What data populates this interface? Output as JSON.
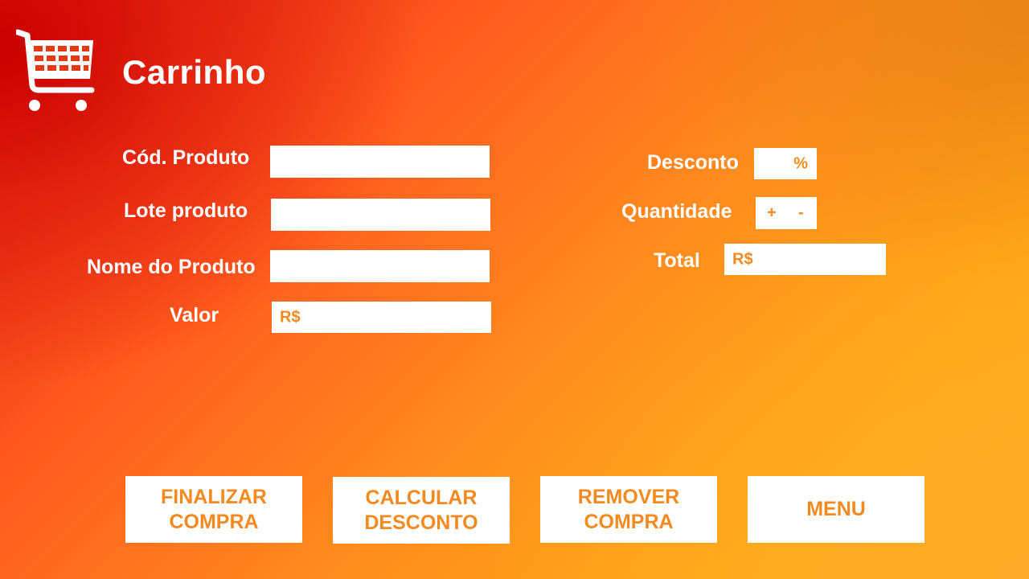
{
  "header": {
    "title": "Carrinho",
    "icon": "shopping-cart-icon"
  },
  "form": {
    "codigo_label": "Cód. Produto",
    "codigo_value": "",
    "lote_label": "Lote produto",
    "lote_value": "",
    "nome_label": "Nome do Produto",
    "nome_value": "",
    "valor_label": "Valor",
    "valor_prefix": "R$",
    "valor_value": "",
    "desconto_label": "Desconto",
    "desconto_suffix": "%",
    "desconto_value": "",
    "quantidade_label": "Quantidade",
    "quantidade_plus": "+",
    "quantidade_minus": "-",
    "total_label": "Total",
    "total_prefix": "R$",
    "total_value": ""
  },
  "actions": {
    "finalizar_line1": "FINALIZAR",
    "finalizar_line2": "COMPRA",
    "calcular_line1": "CALCULAR",
    "calcular_line2": "DESCONTO",
    "remover_line1": "REMOVER",
    "remover_line2": "COMPRA",
    "menu": "MENU"
  },
  "colors": {
    "accent": "#f28a1f",
    "text": "#ffffff",
    "field_bg": "#ffffff"
  }
}
